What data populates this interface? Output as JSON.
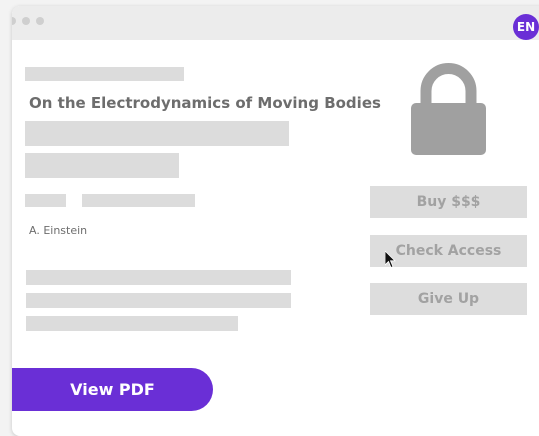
{
  "language_badge": "EN",
  "paper": {
    "title": "On the Electrodynamics of Moving Bodies",
    "author": "A. Einstein"
  },
  "actions": {
    "buy_label": "Buy $$$",
    "check_access_label": "Check Access",
    "give_up_label": "Give Up"
  },
  "view_pdf_label": "View PDF",
  "colors": {
    "accent": "#6a2fd6",
    "placeholder": "#dcdcdc",
    "button": "#dddddd",
    "lock": "#a0a0a0"
  },
  "icons": [
    "lock-icon",
    "mouse-cursor-icon"
  ]
}
